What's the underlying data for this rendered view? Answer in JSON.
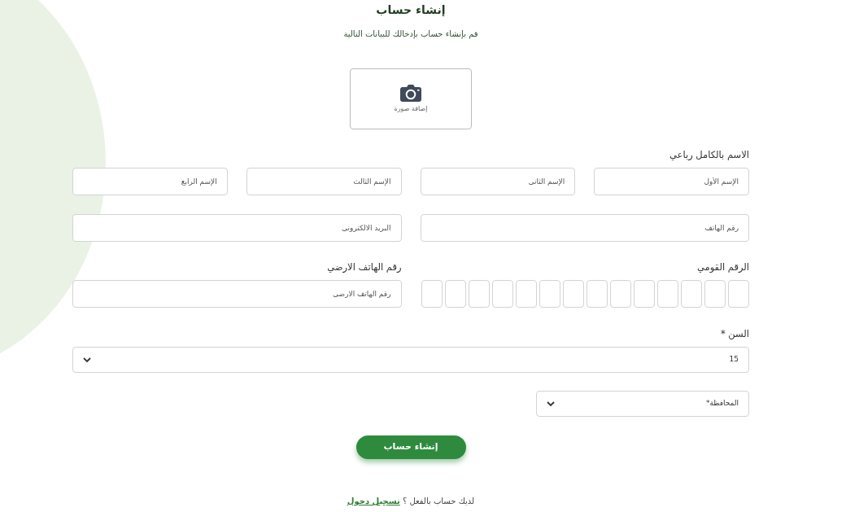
{
  "title": "إنشاء حساب",
  "subtitle": "قم بإنشاء حساب بإدخالك للبيانات التالية",
  "photo_upload": {
    "label": "إضافة صورة"
  },
  "full_name": {
    "label": "الاسم بالكامل رباعي",
    "fields": [
      {
        "placeholder": "الإسم الأول"
      },
      {
        "placeholder": "الإسم الثانى"
      },
      {
        "placeholder": "الإسم الثالث"
      },
      {
        "placeholder": "الإسم الرابع"
      }
    ]
  },
  "contact_fields": [
    {
      "placeholder": "رقم الهاتف"
    },
    {
      "placeholder": "البريد الالكترونى"
    }
  ],
  "national_id": {
    "label": "الرقم القومي"
  },
  "landline": {
    "label": "رقم الهاتف الارضي",
    "placeholder": "رقم الهاتف الارضى"
  },
  "age": {
    "label": "السن *",
    "value": "15"
  },
  "governorate": {
    "value": "المحافظة*"
  },
  "submit_button": "إنشاء حساب",
  "footer": {
    "text": "لديك حساب بالفعل ؟",
    "link": "تسجيل دخول"
  }
}
